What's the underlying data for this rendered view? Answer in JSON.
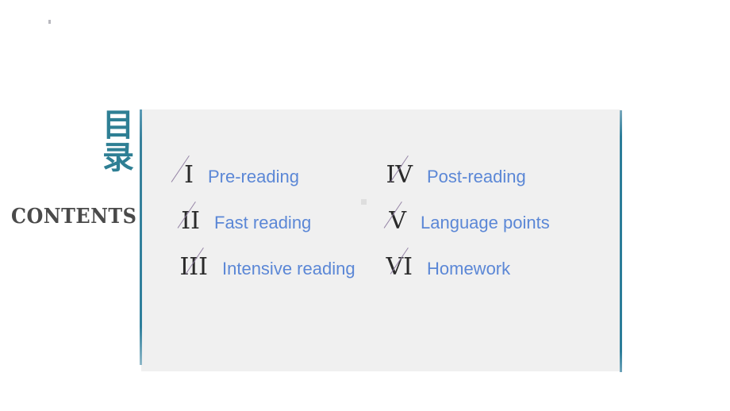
{
  "slide": {
    "background_color": "#ffffff",
    "panel_color": "#f0f0f0",
    "accent_color": "#2e7f9c",
    "heading_color": "#2e7f94",
    "link_color": "#5b87d6",
    "numeral_color": "#2a2a2a",
    "slash_color": "#8d7ba0"
  },
  "heading": {
    "cn_line1": "目",
    "cn_line2": "录",
    "en": "CONTENTS"
  },
  "contents": {
    "left_column": [
      {
        "numeral": "I",
        "label": "Pre-reading"
      },
      {
        "numeral": "II",
        "label": "Fast reading"
      },
      {
        "numeral": "III",
        "label": "Intensive reading"
      }
    ],
    "right_column": [
      {
        "numeral": "IV",
        "label": "Post-reading"
      },
      {
        "numeral": "V",
        "label": "Language points"
      },
      {
        "numeral": "VI",
        "label": "Homework"
      }
    ]
  }
}
